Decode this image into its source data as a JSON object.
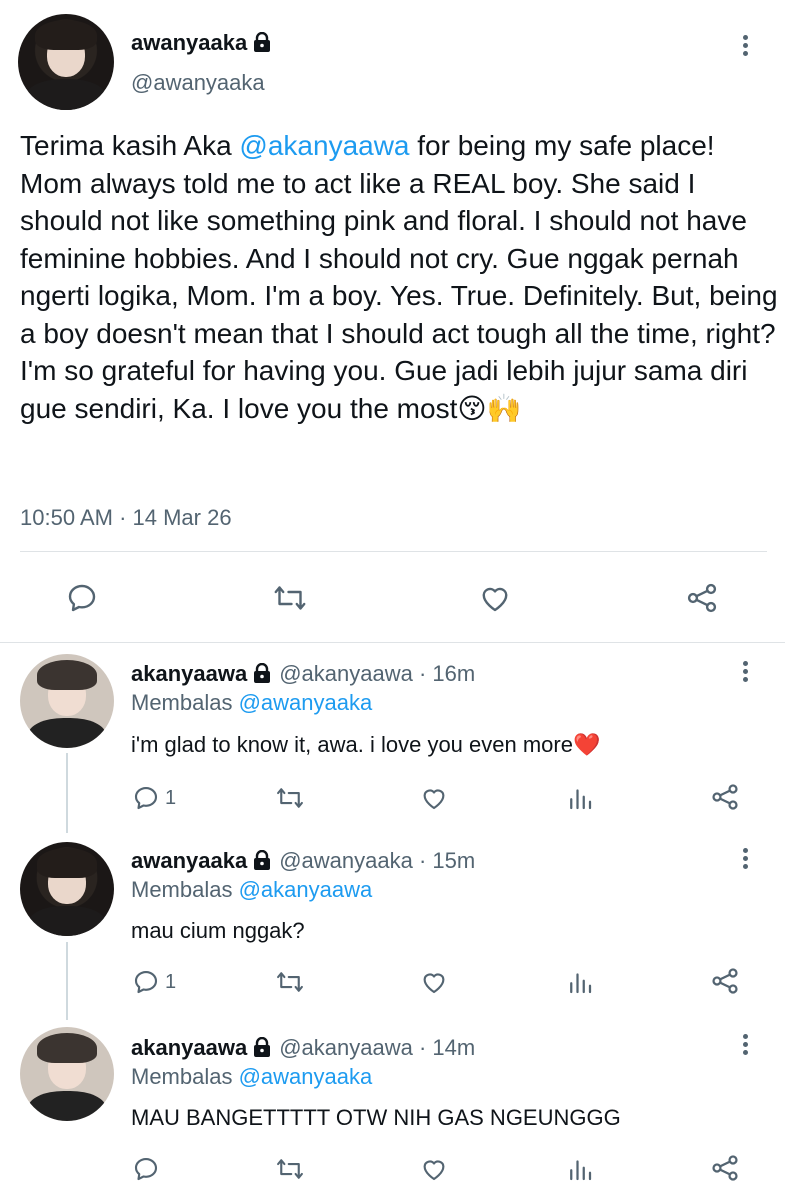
{
  "main_tweet": {
    "display_name": "awanyaaka",
    "handle": "@awanyaaka",
    "text_parts": [
      "Terima kasih Aka ",
      "@akanyaawa",
      " for being my safe place! Mom always told me to act like a REAL boy. She said I should not like something pink and floral. I should not have feminine hobbies. And I should not cry. Gue nggak pernah ngerti logika, Mom. I'm a boy. Yes. True. Definitely. But, being a boy doesn't mean that I should act tough all the time, right? I'm so grateful for having you. Gue jadi lebih jujur sama diri gue sendiri, Ka. I love you the most",
      "😚🙌"
    ],
    "timestamp": "10:50 AM · 14 Mar 26",
    "actions": [
      "reply-icon",
      "retweet-icon",
      "like-icon",
      "share-icon"
    ]
  },
  "replies": [
    {
      "display_name": "akanyaawa",
      "handle_time": "@akanyaawa · 16m",
      "replying_label": "Membalas ",
      "replying_to": "@awanyaaka",
      "text": "i'm glad to know it, awa. i love you even more❤️",
      "reply_count": "1"
    },
    {
      "display_name": "awanyaaka",
      "handle_time": "@awanyaaka · 15m",
      "replying_label": "Membalas ",
      "replying_to": "@akanyaawa",
      "text": "mau cium nggak?",
      "reply_count": "1"
    },
    {
      "display_name": "akanyaawa",
      "handle_time": "@akanyaawa · 14m",
      "replying_label": "Membalas ",
      "replying_to": "@awanyaaka",
      "text": "MAU BANGETTTTT OTW NIH GAS NGEUNGGG",
      "reply_count": ""
    }
  ],
  "colors": {
    "accent": "#1d9bf0",
    "text": "#0f1419",
    "muted": "#536471",
    "divider": "#dfe3e6"
  }
}
